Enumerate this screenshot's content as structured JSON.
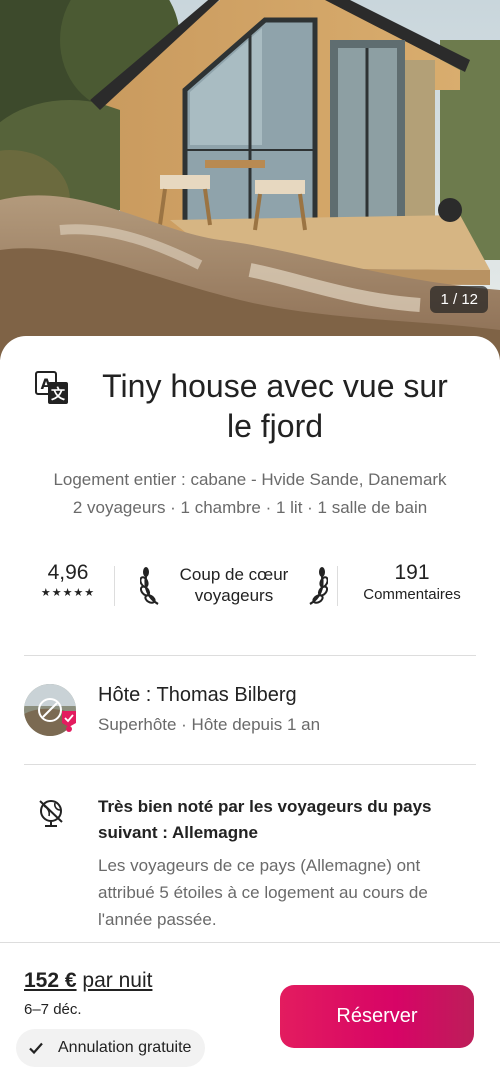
{
  "listing": {
    "photo_counter": "1 / 12",
    "title_line1": "Tiny house avec vue sur",
    "title_line2": "le fjord",
    "subtitle_line1": "Logement entier : cabane - Hvide Sande, Danemark",
    "subtitle_line2": "2 voyageurs · 1 chambre · 1 lit · 1 salle de bain"
  },
  "stats": {
    "rating": "4,96",
    "stars": "★★★★★",
    "star_count": 5,
    "fav_line1": "Coup de cœur",
    "fav_line2": "voyageurs",
    "reviews_count": "191",
    "reviews_label": "Commentaires"
  },
  "host": {
    "name": "Hôte : Thomas Bilberg",
    "sub": "Superhôte · Hôte depuis 1 an"
  },
  "feature": {
    "title_line1": "Très bien noté par les voyageurs du pays",
    "title_line2": "suivant : Allemagne",
    "desc_line1": "Les voyageurs de ce pays (Allemagne) ont",
    "desc_line2": "attribué 5 étoiles à ce logement au cours de",
    "desc_line3": "l'année passée."
  },
  "footer": {
    "price_amount": "152 €",
    "price_unit": "par nuit",
    "dates": "6–7 déc.",
    "cancellation": "Annulation gratuite",
    "reserve_label": "Réserver"
  },
  "colors": {
    "brand": "#e31c5f",
    "brand_dark": "#bd1e59",
    "text": "#222222",
    "muted": "#6a6a6a",
    "divider": "#dddddd"
  },
  "icons": {
    "translate": "translate-icon",
    "laurel": "laurel-icon",
    "globe": "globe-crossed-icon",
    "check": "check-icon",
    "superhost": "superhost-badge-icon"
  }
}
